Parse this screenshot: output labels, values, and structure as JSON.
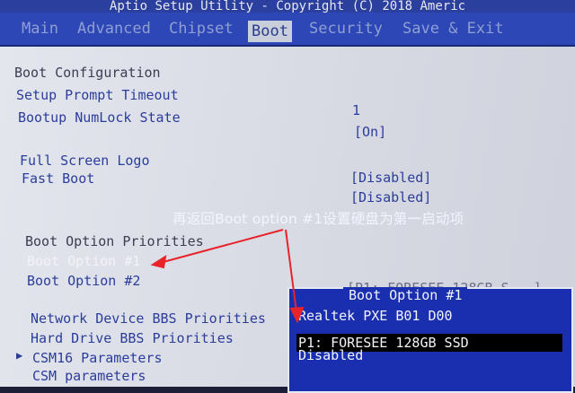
{
  "window": {
    "title": "Aptio Setup Utility - Copyright (C) 2018 Americ"
  },
  "menu": {
    "tabs": [
      {
        "label": "Main"
      },
      {
        "label": "Advanced"
      },
      {
        "label": "Chipset"
      },
      {
        "label": "Boot"
      },
      {
        "label": "Security"
      },
      {
        "label": "Save & Exit"
      }
    ]
  },
  "boot": {
    "configuration_heading": "Boot Configuration",
    "setup_prompt_timeout": {
      "label": "Setup Prompt Timeout",
      "value": "1"
    },
    "bootup_numlock": {
      "label": "Bootup NumLock State",
      "value": "[On]"
    },
    "full_screen_logo": {
      "label": "Full Screen Logo",
      "value": "[Disabled]"
    },
    "fast_boot": {
      "label": "Fast Boot",
      "value": "[Disabled]"
    },
    "priorities_heading": "Boot Option Priorities",
    "boot_option_1": {
      "label": "Boot Option #1"
    },
    "boot_option_2": {
      "label": "Boot Option #2",
      "value": "[P1: FORESEE 128GB S...]"
    },
    "network_bbs": {
      "label": "Network Device BBS Priorities"
    },
    "hdd_bbs": {
      "label": "Hard Drive BBS Priorities"
    },
    "csm16": {
      "label": "CSM16 Parameters"
    },
    "csm": {
      "label": "CSM parameters"
    }
  },
  "popup": {
    "title": "Boot Option #1",
    "options": [
      "Realtek PXE B01 D00",
      "P1: FORESEE 128GB SSD",
      "Disabled"
    ]
  },
  "annotation": {
    "text": "再返回Boot option #1设置硬盘为第一启动项"
  },
  "colors": {
    "annotation_arrow": "#e8232a",
    "menu_bar": "#2d47b6",
    "popup_bg": "#1a2fb0"
  },
  "icons": {
    "submenu_marker": "triangle-right-icon"
  }
}
